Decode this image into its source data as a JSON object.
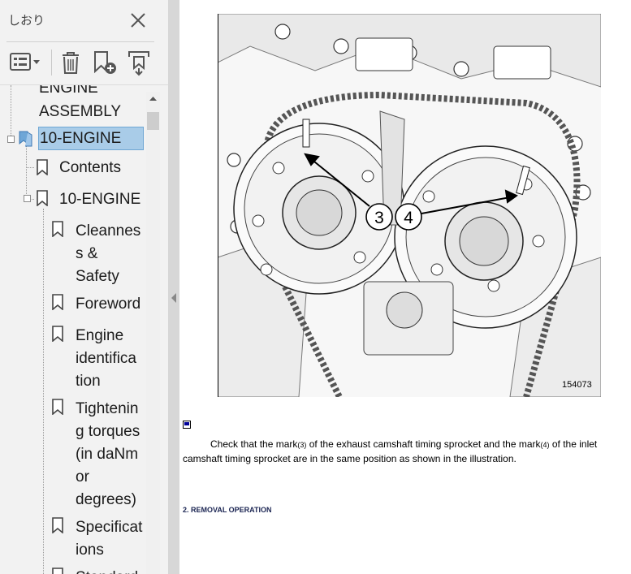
{
  "panel": {
    "title": "しおり",
    "toolbar": {
      "options_icon": "list-options-icon",
      "delete_icon": "trash-icon",
      "new_bookmark_icon": "bookmark-add-icon",
      "find_icon": "find-bookmark-icon"
    },
    "tree": {
      "partial_top": "ENGINE",
      "assembly": "ASSEMBLY",
      "selected": "10-ENGINE",
      "contents": "Contents",
      "section": "10-ENGINE",
      "items": [
        [
          "Cleannes",
          "s &",
          "Safety"
        ],
        [
          "Foreword"
        ],
        [
          "Engine",
          "identifica",
          "tion"
        ],
        [
          "Tightenin",
          "g torques",
          "(in daNm",
          "or",
          "degrees)"
        ],
        [
          "Specificat",
          "ions"
        ],
        [
          "Standard"
        ]
      ]
    }
  },
  "document": {
    "callouts": [
      "3",
      "4"
    ],
    "figure_id": "154073",
    "paragraph": {
      "p1": "Check that the mark",
      "mark3": "(3)",
      "p2": " of the exhaust camshaft timing sprocket and the mark",
      "mark4": "(4)",
      "p3": " of the inlet camshaft timing sprocket are in the same position as shown in the illustration."
    },
    "section_heading": "2. REMOVAL OPERATION"
  },
  "colors": {
    "panel_bg": "#f2f2f2",
    "selection_bg": "#a9cce8",
    "selection_border": "#6fa7d4",
    "heading": "#1a2452"
  }
}
